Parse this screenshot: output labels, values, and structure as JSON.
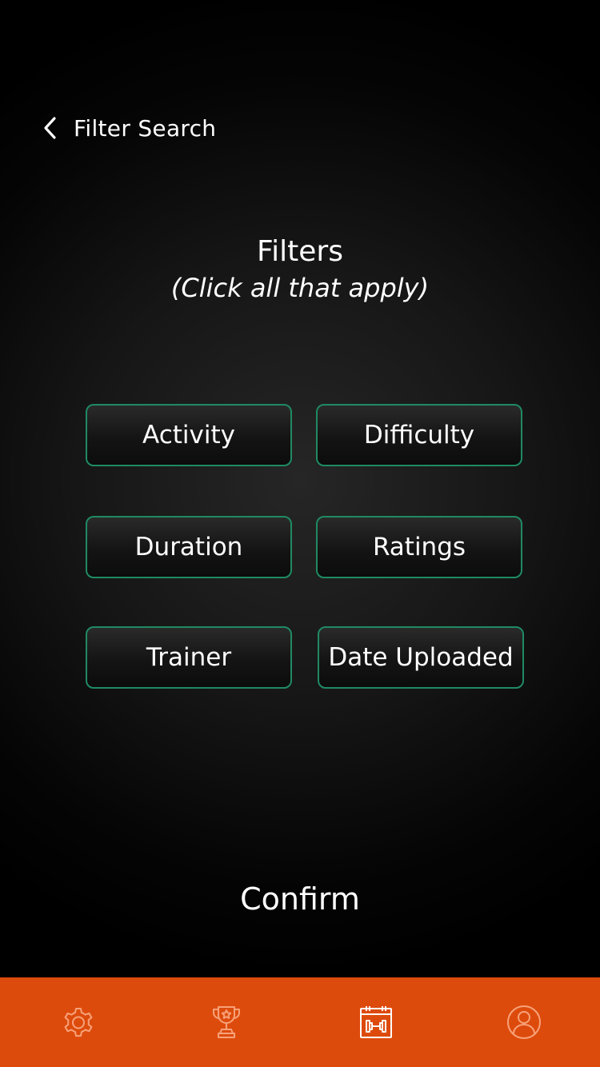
{
  "header": {
    "back_icon": "chevron-left-icon",
    "title": "Filter Search"
  },
  "main": {
    "title": "Filters",
    "subtitle": "(Click all that apply)",
    "filters": [
      {
        "label": "Activity"
      },
      {
        "label": "Difficulty"
      },
      {
        "label": "Duration"
      },
      {
        "label": "Ratings"
      },
      {
        "label": "Trainer"
      },
      {
        "label": "Date Uploaded"
      }
    ],
    "confirm_label": "Confirm"
  },
  "tabbar": {
    "items": [
      {
        "icon": "gear-icon"
      },
      {
        "icon": "trophy-icon"
      },
      {
        "icon": "calendar-dumbbell-icon"
      },
      {
        "icon": "user-icon"
      }
    ]
  },
  "colors": {
    "accent_border": "#1f8a63",
    "tabbar_bg": "#dd4b0c",
    "tab_icon": "#f7a27a"
  }
}
